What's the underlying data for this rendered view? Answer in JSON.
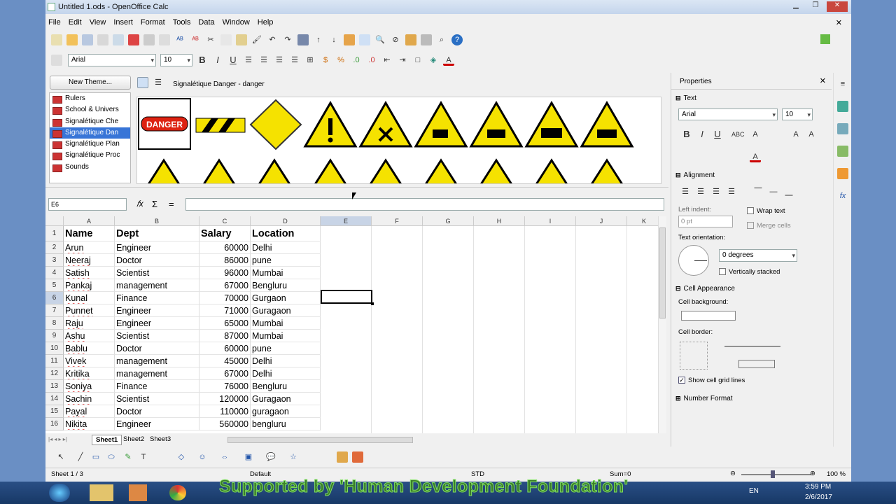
{
  "window": {
    "title": "Untitled 1.ods - OpenOffice Calc"
  },
  "menu": [
    "File",
    "Edit",
    "View",
    "Insert",
    "Format",
    "Tools",
    "Data",
    "Window",
    "Help"
  ],
  "format_toolbar": {
    "font": "Arial",
    "size": "10"
  },
  "gallery": {
    "new_theme_label": "New Theme...",
    "title": "Signalétique Danger - danger",
    "themes": [
      "Rulers",
      "School & Univers",
      "Signalétique Che",
      "Signalétique Dan",
      "Signalétique Plan",
      "Signalétique Proc",
      "Sounds"
    ],
    "active_theme_index": 3,
    "first_sign_label": "DANGER"
  },
  "formula_bar": {
    "cell_ref": "E6",
    "value": ""
  },
  "columns": [
    "A",
    "B",
    "C",
    "D",
    "E",
    "F",
    "G",
    "H",
    "I",
    "J",
    "K"
  ],
  "active_col": "E",
  "active_row": 6,
  "rows": [
    [
      "Name",
      "Dept",
      "Salary",
      "Location"
    ],
    [
      "Arun",
      "Engineer",
      "60000",
      "Delhi"
    ],
    [
      "Neeraj",
      "Doctor",
      "86000",
      "pune"
    ],
    [
      "Satish",
      "Scientist",
      "96000",
      "Mumbai"
    ],
    [
      "Pankaj",
      "management",
      "67000",
      "Bengluru"
    ],
    [
      "Kunal",
      "Finance",
      "70000",
      "Gurgaon"
    ],
    [
      "Punnet",
      "Engineer",
      "71000",
      "Guragaon"
    ],
    [
      "Raju",
      "Engineer",
      "65000",
      "Mumbai"
    ],
    [
      "Ashu",
      "Scientist",
      "87000",
      "Mumbai"
    ],
    [
      "Bablu",
      "Doctor",
      "60000",
      "pune"
    ],
    [
      "Vivek",
      "management",
      "45000",
      "Delhi"
    ],
    [
      "Kritika",
      "management",
      "67000",
      "Delhi"
    ],
    [
      "Soniya",
      "Finance",
      "76000",
      "Bengluru"
    ],
    [
      "Sachin",
      "Scientist",
      "120000",
      "Guragaon"
    ],
    [
      "Payal",
      "Doctor",
      "110000",
      "guragaon"
    ],
    [
      "Nikita",
      "Engineer",
      "560000",
      "bengluru"
    ]
  ],
  "sheet_tabs": [
    "Sheet1",
    "Sheet2",
    "Sheet3"
  ],
  "status": {
    "sheet": "Sheet 1 / 3",
    "style": "Default",
    "mode": "STD",
    "sum": "Sum=0",
    "zoom": "100 %"
  },
  "properties": {
    "title": "Properties",
    "text_section": "Text",
    "font": "Arial",
    "size": "10",
    "alignment_section": "Alignment",
    "left_indent_label": "Left indent:",
    "left_indent_value": "0 pt",
    "wrap_text": "Wrap text",
    "merge_cells": "Merge cells",
    "orientation_label": "Text orientation:",
    "orientation_value": "0 degrees",
    "vertically_stacked": "Vertically stacked",
    "cell_appearance_section": "Cell Appearance",
    "cell_background_label": "Cell background:",
    "cell_border_label": "Cell border:",
    "show_grid_lines": "Show cell grid lines",
    "number_format_section": "Number Format"
  },
  "taskbar": {
    "lang": "EN",
    "time": "3:59 PM",
    "date": "2/6/2017"
  },
  "watermark": "Supported by 'Human Development Foundation'"
}
